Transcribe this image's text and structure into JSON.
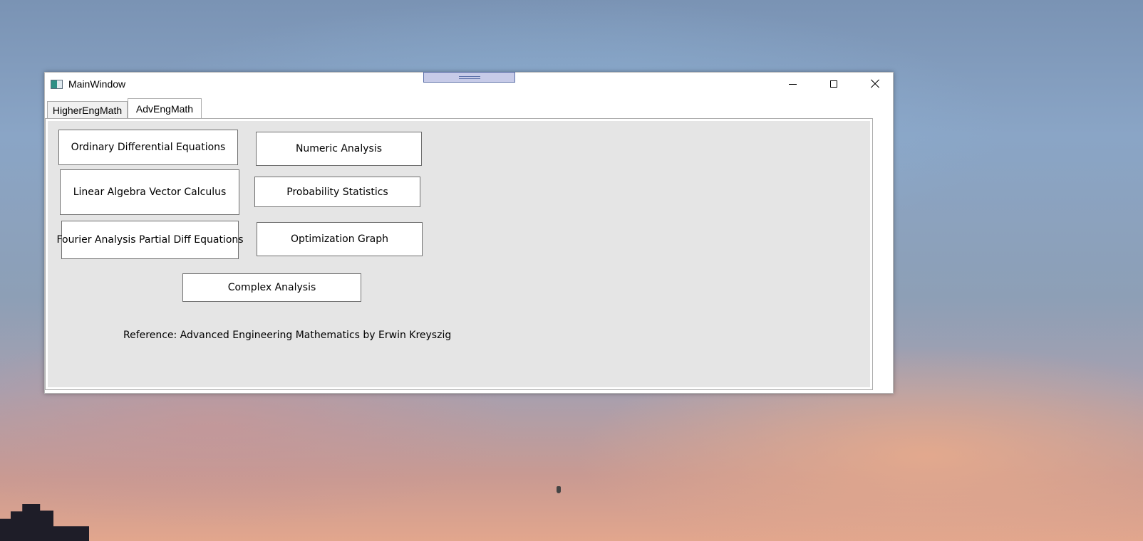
{
  "window": {
    "title": "MainWindow",
    "controls": {
      "minimize_icon": "minimize-icon",
      "maximize_icon": "maximize-icon",
      "close_icon": "close-icon"
    }
  },
  "tabs": [
    {
      "label": "HigherEngMath",
      "selected": false
    },
    {
      "label": "AdvEngMath",
      "selected": true
    }
  ],
  "buttons": {
    "ode": "Ordinary Differential Equations",
    "numeric": "Numeric Analysis",
    "linear": "Linear Algebra Vector Calculus",
    "probability": "Probability Statistics",
    "fourier": "Fourier Analysis Partial Diff Equations",
    "optimization": "Optimization Graph",
    "complex": "Complex Analysis"
  },
  "reference": "Reference: Advanced Engineering Mathematics by Erwin Kreyszig"
}
